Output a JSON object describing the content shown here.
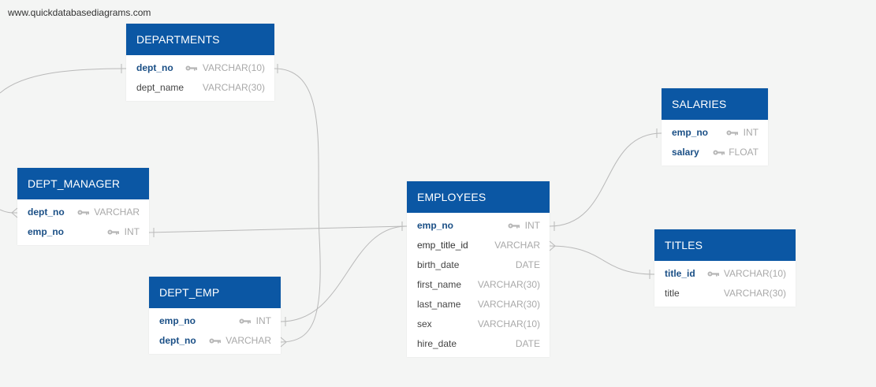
{
  "watermark": "www.quickdatabasediagrams.com",
  "tables": {
    "departments": {
      "title": "DEPARTMENTS",
      "rows": [
        {
          "name": "dept_no",
          "type": "VARCHAR(10)"
        },
        {
          "name": "dept_name",
          "type": "VARCHAR(30)"
        }
      ]
    },
    "dept_manager": {
      "title": "DEPT_MANAGER",
      "rows": [
        {
          "name": "dept_no",
          "type": "VARCHAR"
        },
        {
          "name": "emp_no",
          "type": "INT"
        }
      ]
    },
    "dept_emp": {
      "title": "DEPT_EMP",
      "rows": [
        {
          "name": "emp_no",
          "type": "INT"
        },
        {
          "name": "dept_no",
          "type": "VARCHAR"
        }
      ]
    },
    "employees": {
      "title": "EMPLOYEES",
      "rows": [
        {
          "name": "emp_no",
          "type": "INT"
        },
        {
          "name": "emp_title_id",
          "type": "VARCHAR"
        },
        {
          "name": "birth_date",
          "type": "DATE"
        },
        {
          "name": "first_name",
          "type": "VARCHAR(30)"
        },
        {
          "name": "last_name",
          "type": "VARCHAR(30)"
        },
        {
          "name": "sex",
          "type": "VARCHAR(10)"
        },
        {
          "name": "hire_date",
          "type": "DATE"
        }
      ]
    },
    "salaries": {
      "title": "SALARIES",
      "rows": [
        {
          "name": "emp_no",
          "type": "INT"
        },
        {
          "name": "salary",
          "type": "FLOAT"
        }
      ]
    },
    "titles": {
      "title": "TITLES",
      "rows": [
        {
          "name": "title_id",
          "type": "VARCHAR(10)"
        },
        {
          "name": "title",
          "type": "VARCHAR(30)"
        }
      ]
    }
  },
  "colors": {
    "header": "#0b57a4",
    "key_field": "#1a4f86",
    "type_text": "#a9a9a9",
    "connector": "#b9b9b9"
  }
}
